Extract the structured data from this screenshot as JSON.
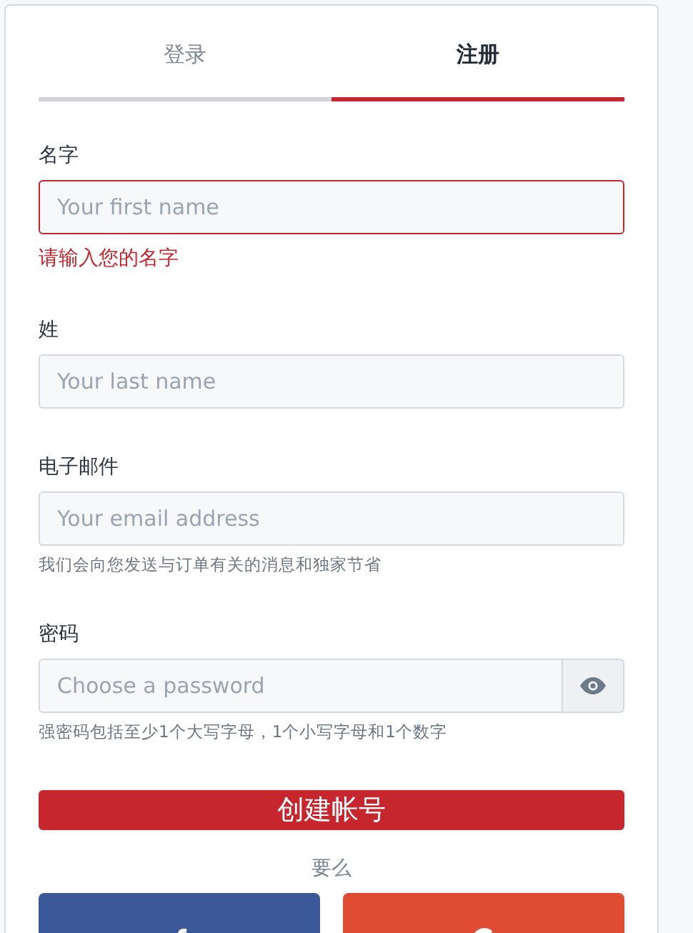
{
  "tabs": [
    {
      "label": "登录",
      "selected": false
    },
    {
      "label": "注册",
      "selected": true
    }
  ],
  "fields": [
    {
      "label": "名字",
      "placeholder": "Your first name",
      "error": "请输入您的名字"
    },
    {
      "label": "姓",
      "placeholder": "Your last name"
    },
    {
      "label": "电子邮件",
      "placeholder": "Your email address",
      "hint": "我们会向您发送与订单有关的消息和独家节省"
    },
    {
      "label": "密码",
      "placeholder": "Choose a password",
      "kind": "password",
      "hint": "强密码包括至少1个大写字母，1个小写字母和1个数字"
    }
  ],
  "submit": "创建帐号",
  "divider": "要么",
  "social": [
    {
      "kind": "facebook",
      "color": "#3b5998"
    },
    {
      "kind": "google",
      "color": "#e04b33"
    }
  ]
}
